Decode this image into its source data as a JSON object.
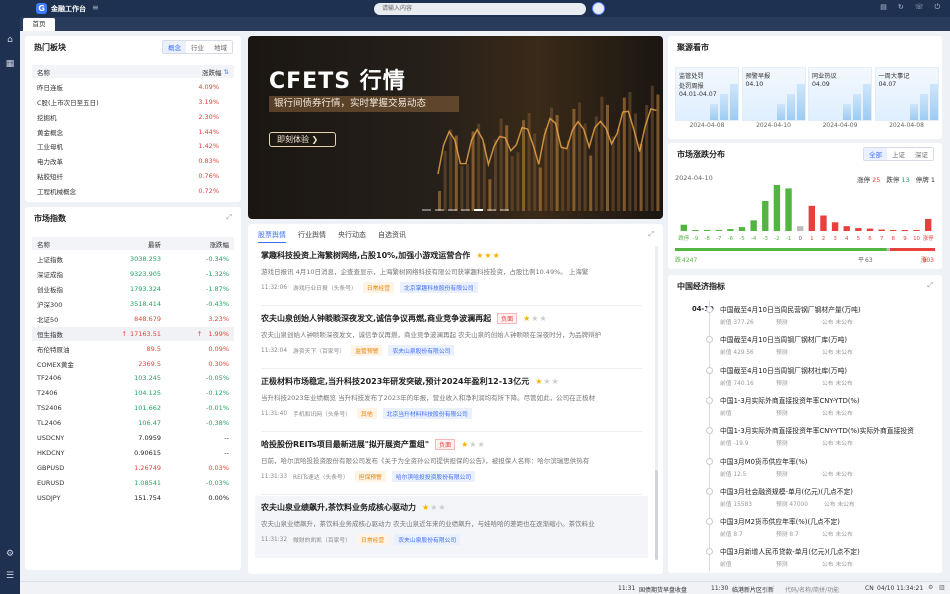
{
  "app": {
    "title": "金融工作台",
    "home_tab": "首页"
  },
  "search": {
    "placeholder": "请输入内容"
  },
  "hot_sectors": {
    "title": "热门板块",
    "tabs": [
      "概念",
      "行业",
      "地域"
    ],
    "active_tab": "概念",
    "col_name": "名称",
    "col_change": "涨跌幅",
    "rows": [
      {
        "name": "昨日连板",
        "change": "4.09%"
      },
      {
        "name": "C股(上市次日至五日)",
        "change": "3.19%"
      },
      {
        "name": "挖掘机",
        "change": "2.30%"
      },
      {
        "name": "黄金概念",
        "change": "1.44%"
      },
      {
        "name": "工业母机",
        "change": "1.42%"
      },
      {
        "name": "电力改革",
        "change": "0.83%"
      },
      {
        "name": "粘胶短纤",
        "change": "0.76%"
      },
      {
        "name": "工程机械概念",
        "change": "0.72%"
      }
    ]
  },
  "market_index": {
    "title": "市场指数",
    "col_name": "名称",
    "col_latest": "最新",
    "col_change": "涨跌幅",
    "rows": [
      {
        "name": "上证指数",
        "latest": "3038.253",
        "change": "-0.34%",
        "dir": "down"
      },
      {
        "name": "深证成指",
        "latest": "9323.905",
        "change": "-1.32%",
        "dir": "down"
      },
      {
        "name": "创业板指",
        "latest": "1793.324",
        "change": "-1.87%",
        "dir": "down"
      },
      {
        "name": "沪深300",
        "latest": "3518.414",
        "change": "-0.43%",
        "dir": "down"
      },
      {
        "name": "北证50",
        "latest": "848.679",
        "change": "3.23%",
        "dir": "up"
      },
      {
        "name": "恒生指数",
        "latest": "17163.51",
        "change": "1.99%",
        "dir": "up",
        "arrow": "↑",
        "highlight": true
      },
      {
        "name": "布伦特原油",
        "latest": "89.5",
        "change": "0.09%",
        "dir": "up"
      },
      {
        "name": "COMEX黄金",
        "latest": "2369.5",
        "change": "0.30%",
        "dir": "up"
      },
      {
        "name": "TF2406",
        "latest": "103.245",
        "change": "-0.05%",
        "dir": "down"
      },
      {
        "name": "T2406",
        "latest": "104.125",
        "change": "-0.12%",
        "dir": "down"
      },
      {
        "name": "TS2406",
        "latest": "101.662",
        "change": "-0.01%",
        "dir": "down"
      },
      {
        "name": "TL2406",
        "latest": "106.47",
        "change": "-0.38%",
        "dir": "down"
      },
      {
        "name": "USDCNY",
        "latest": "7.0959",
        "change": "--",
        "dir": "flat"
      },
      {
        "name": "HKDCNY",
        "latest": "0.90615",
        "change": "--",
        "dir": "flat"
      },
      {
        "name": "GBPUSD",
        "latest": "1.26749",
        "change": "0.03%",
        "dir": "up"
      },
      {
        "name": "EURUSD",
        "latest": "1.08541",
        "change": "-0.03%",
        "dir": "down"
      },
      {
        "name": "USDJPY",
        "latest": "151.754",
        "change": "0.00%",
        "dir": "flat"
      }
    ]
  },
  "banner": {
    "title": "CFETS 行情",
    "subtitle": "银行间债券行情，实时掌握交易动态",
    "button": "即刻体验 ❯"
  },
  "news": {
    "tabs": [
      "股票舆情",
      "行业舆情",
      "央行动态",
      "自选资讯"
    ],
    "active_tab": "股票舆情",
    "items": [
      {
        "title": "掌趣科技投资上海繁树网络,占股10%,加强小游戏运营合作",
        "negative": "",
        "stars": 3,
        "body": "游戏日报讯 4月10日消息，企查查显示，上海繁树网络科技有限公司获掌趣科技投资，占股比例10.49%。 上海繁",
        "time": "11:32:06",
        "source": "游戏行业日报（头条号）",
        "tag": "日常经营",
        "company": "北京掌趣科技股份有限公司"
      },
      {
        "title": "农夫山泉创始人钟睒睒深夜发文,诚信争议再燃,商业竞争波澜再起",
        "negative": "负面",
        "stars": 1,
        "body": "农夫山泉创始人钟睒睒深夜发文，诚信争议再燃，商业竞争波澜再起 农夫山泉的创始人钟睒睒在深夜时分，为品牌辩护",
        "time": "11:32:04",
        "source": "游资天下（百家号）",
        "tag": "监管预警",
        "company": "农夫山泉股份有限公司"
      },
      {
        "title": "正极材料市场稳定,当升科技2023年研发突破,预计2024年盈利12-13亿元",
        "negative": "",
        "stars": 1,
        "body": "当升科技2023年业绩概览 当升科技发布了2023年的年报，营业收入和净利润均有所下降。尽管如此，公司在正极材",
        "time": "11:31:40",
        "source": "手机和讯网（头条号）",
        "tag": "其他",
        "company": "北京当升材料科技股份有限公司"
      },
      {
        "title": "哈投股份REITs项目最新进展\"拟开展资产重组\"",
        "negative": "负面",
        "stars": 1,
        "body": "日前，哈尔滨哈投投资股份有限公司发布《关于为全资孙公司提供担保的公告》，被担保人名称：哈尔滨瑞思供热有",
        "time": "11:31:33",
        "source": "REITs速达（头条号）",
        "tag": "担保预警",
        "company": "哈尔滨哈投投资股份有限公司"
      },
      {
        "title": "农夫山泉业绩飙升,茶饮料业务成核心驱动力",
        "negative": "",
        "stars": 1,
        "body": "农夫山泉业绩飙升，茶饮料业务成核心驱动力 农夫山泉近年来的业绩飙升，与娃哈哈的差距也在逐渐缩小。茶饮料业",
        "time": "11:31:32",
        "source": "微财的凯凯（百家号）",
        "tag": "日常经营",
        "company": "农夫山泉股份有限公司"
      }
    ]
  },
  "sources": {
    "title": "聚源看市",
    "cards": [
      {
        "line1": "监管处罚",
        "line2": "处罚周报",
        "line3": "04.01-04.07",
        "date": "2024-04-08"
      },
      {
        "line1": "预警早报",
        "line2": "04.10",
        "line3": "",
        "date": "2024-04-10"
      },
      {
        "line1": "同业热议",
        "line2": "04.09",
        "line3": "",
        "date": "2024-04-09"
      },
      {
        "line1": "一周大事记",
        "line2": "04.07",
        "line3": "",
        "date": "2024-04-08"
      }
    ]
  },
  "dist": {
    "title": "市场涨跌分布",
    "tabs": [
      "全部",
      "上证",
      "深证"
    ],
    "active_tab": "全部",
    "date": "2024-04-10",
    "limit_up_label": "涨停",
    "limit_up": "25",
    "limit_down_label": "跌停",
    "limit_down": "13",
    "halt_label": "停牌",
    "halt": "1",
    "left_label": "跌停",
    "right_label": "涨停",
    "down_count": "4247",
    "flat_count": "63",
    "up_count": "903",
    "flat_label": "平",
    "down_label": "跌",
    "up_label": "涨",
    "colors": {
      "up": "#e8413d",
      "down": "#52b53f"
    }
  },
  "chart_data": {
    "type": "bar",
    "categories": [
      "跌停",
      "-9",
      "-8",
      "-7",
      "-6",
      "-5",
      "-4",
      "-3",
      "-2",
      "-1",
      "0",
      "1",
      "2",
      "3",
      "4",
      "5",
      "6",
      "7",
      "8",
      "9",
      "10",
      "涨停"
    ],
    "values": [
      13,
      1,
      1,
      2,
      4,
      8,
      22,
      62,
      95,
      88,
      10,
      52,
      32,
      18,
      10,
      6,
      5,
      3,
      2,
      2,
      2,
      25
    ],
    "title": "",
    "xlabel": "",
    "ylabel": ""
  },
  "econ": {
    "title": "中国经济指标",
    "date": "04-10",
    "items": [
      {
        "title": "中国截至4月10日当周民营钢厂钢材产量(万吨)",
        "prev": "前值 377.26",
        "pred": "预测",
        "pub": "公布 未公布"
      },
      {
        "title": "中国截至4月10日当周钢厂钢材厂库(万吨)",
        "prev": "前值 429.56",
        "pred": "预测",
        "pub": "公布 未公布"
      },
      {
        "title": "中国截至4月10日当周钢厂钢材社库(万吨)",
        "prev": "前值 740.16",
        "pred": "预测",
        "pub": "公布 未公布"
      },
      {
        "title": "中国1-3月实际外商直接投资年率CNY-YTD(%)",
        "prev": "前值",
        "pred": "预测",
        "pub": "公布 未公布"
      },
      {
        "title": "中国1-3月实际外商直接投资年率CNY-YTD(%)实际外商直接投资",
        "prev": "前值 -19.9",
        "pred": "预测",
        "pub": "公布 未公布"
      },
      {
        "title": "中国3月M0货币供应年率(%)",
        "prev": "前值 12.5",
        "pred": "预测",
        "pub": "公布 未公布"
      },
      {
        "title": "中国3月社会融资规模-单月(亿元)(几点不定)",
        "prev": "前值 15583",
        "pred": "预测 47000",
        "pub": "公布 未公布"
      },
      {
        "title": "中国3月M2货币供应年率(%)(几点不定)",
        "prev": "前值 8.7",
        "pred": "预测 8.7",
        "pub": "公布 未公布"
      },
      {
        "title": "中国3月新增人民币贷款-单月(亿元)(几点不定)",
        "prev": "前值",
        "pred": "预测",
        "pub": "公布 未公布"
      }
    ]
  },
  "statusbar": {
    "t1": "11:31",
    "m1": "国债期货早盘收盘",
    "t2": "11:30",
    "m2": "临港新片区引新",
    "input_hint": "代码/名称/简拼/功能",
    "cn": "CN",
    "datetime": "04/10 11:34:21"
  }
}
